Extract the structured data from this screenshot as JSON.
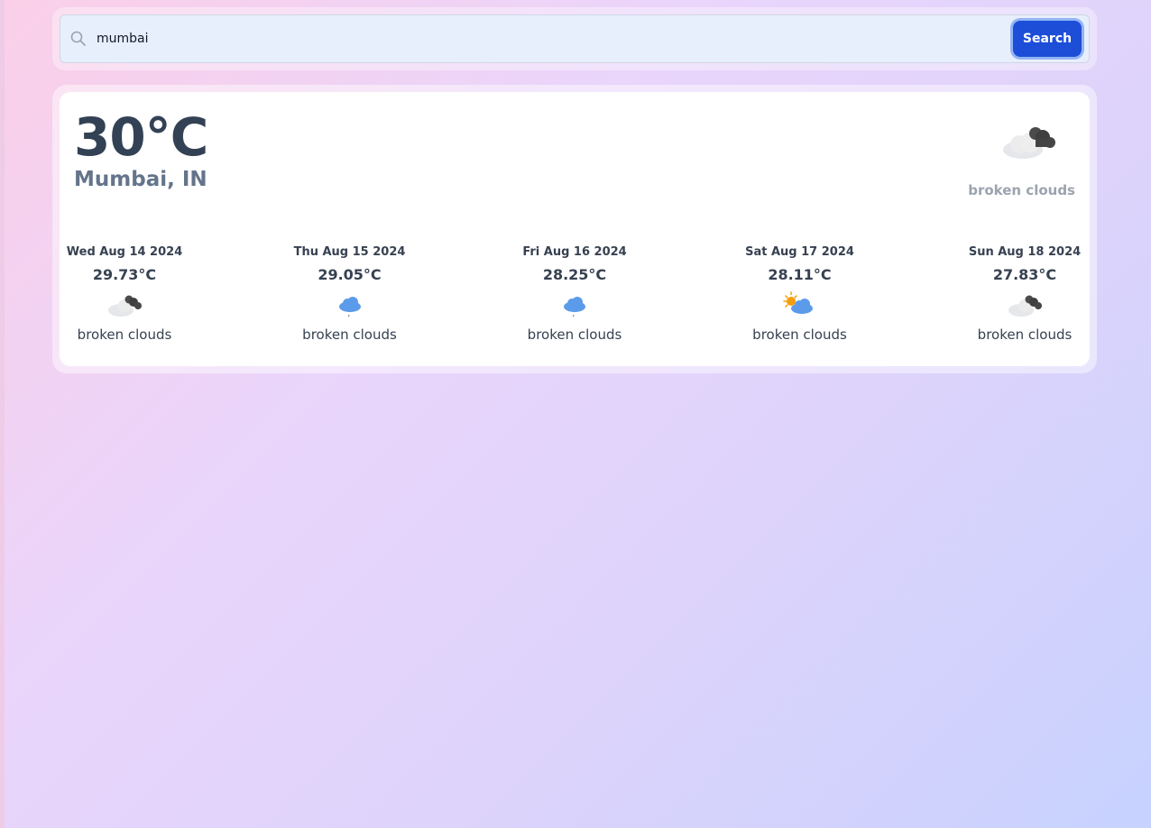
{
  "search": {
    "value": "mumbai",
    "icon": "search-icon",
    "button_label": "Search"
  },
  "current": {
    "temperature": "30°C",
    "location": "Mumbai, IN",
    "icon": "broken-clouds-icon",
    "description": "broken clouds"
  },
  "forecast": [
    {
      "date": "Wed Aug 14 2024",
      "temperature": "29.73°C",
      "icon": "broken-clouds-icon",
      "description": "broken clouds"
    },
    {
      "date": "Thu Aug 15 2024",
      "temperature": "29.05°C",
      "icon": "rain-cloud-icon",
      "description": "broken clouds"
    },
    {
      "date": "Fri Aug 16 2024",
      "temperature": "28.25°C",
      "icon": "rain-cloud-icon",
      "description": "broken clouds"
    },
    {
      "date": "Sat Aug 17 2024",
      "temperature": "28.11°C",
      "icon": "sun-cloud-icon",
      "description": "broken clouds"
    },
    {
      "date": "Sun Aug 18 2024",
      "temperature": "27.83°C",
      "icon": "broken-clouds-icon",
      "description": "broken clouds"
    }
  ],
  "colors": {
    "accent": "#1d4ed8",
    "temp_text": "#334155",
    "city_text": "#64748b",
    "muted_text": "#9ca3af"
  }
}
